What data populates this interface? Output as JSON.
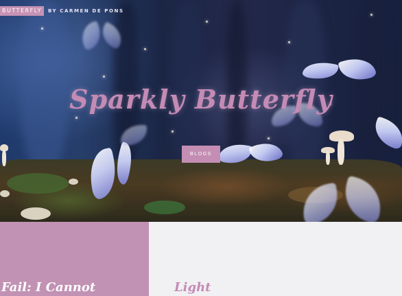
{
  "header": {
    "brand": "BUTTERFLY",
    "byline": "BY CARMEN DE PONS"
  },
  "hero": {
    "title": "Sparkly Butterfly",
    "cta_label": "BLOGS"
  },
  "cards": [
    {
      "title": "Fail: I Cannot",
      "background": "#c192b4",
      "text_color": "#ffffff"
    },
    {
      "title": "Light",
      "background": "#f1f1f3",
      "text_color": "#c48bb5"
    }
  ],
  "colors": {
    "accent": "#c48db3"
  }
}
